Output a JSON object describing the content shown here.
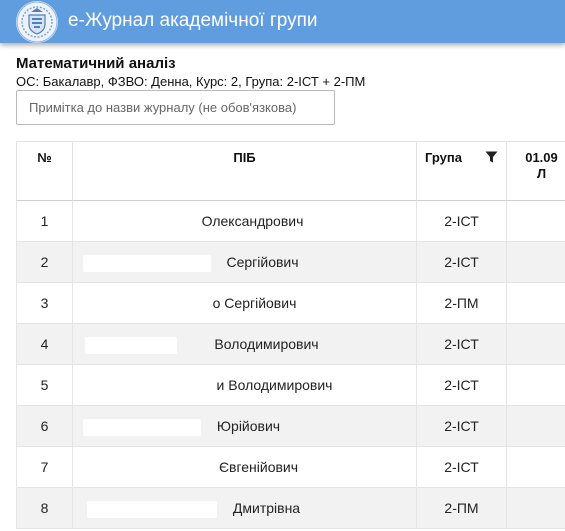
{
  "app": {
    "title": "е-Журнал академічної групи",
    "logo_icon": "university-crest-icon",
    "header_color": "#5f9dde"
  },
  "course": {
    "title": "Математичний аналіз",
    "subtitle": "ОС: Бакалавр, ФЗВО: Денна, Курс: 2, Група: 2-ІСТ + 2-ПМ"
  },
  "note": {
    "value": "",
    "placeholder": "Примітка до назви журналу (не обов'язкова)"
  },
  "table": {
    "headers": {
      "num": "№",
      "name": "ПІБ",
      "group": "Група",
      "group_filter_icon": "filter-icon",
      "date": "01.09",
      "date_type": "Л"
    },
    "rows": [
      {
        "num": "1",
        "name": "Олександрович",
        "group": "2-ІСТ"
      },
      {
        "num": "2",
        "name": "Сергійович",
        "group": "2-ІСТ"
      },
      {
        "num": "3",
        "name": "о Сергійович",
        "group": "2-ПМ"
      },
      {
        "num": "4",
        "name": "Володимирович",
        "group": "2-ІСТ"
      },
      {
        "num": "5",
        "name": "и Володимирович",
        "group": "2-ІСТ"
      },
      {
        "num": "6",
        "name": "Юрійович",
        "group": "2-ІСТ"
      },
      {
        "num": "7",
        "name": "Євгенійович",
        "group": "2-ІСТ"
      },
      {
        "num": "8",
        "name": "Дмитрівна",
        "group": "2-ПМ"
      }
    ]
  }
}
